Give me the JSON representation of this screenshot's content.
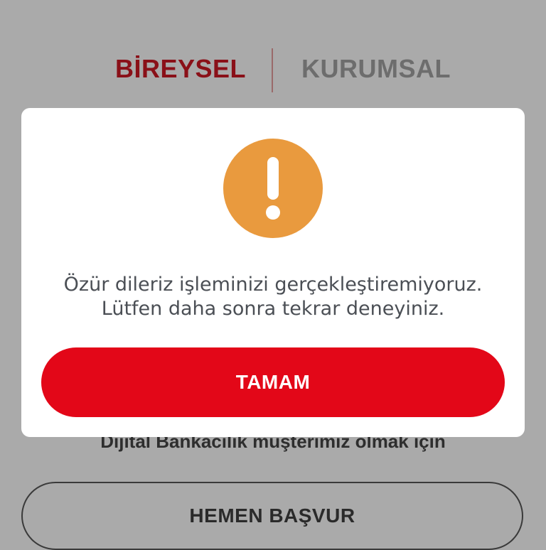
{
  "tabs": {
    "active_label": "BİREYSEL",
    "inactive_label": "KURUMSAL"
  },
  "background": {
    "subtext": "Dijital Bankacılık müşterimiz olmak için",
    "apply_button_label": "HEMEN BAŞVUR"
  },
  "dialog": {
    "icon": "warning-exclamation-icon",
    "message_line1": "Özür dileriz işleminizi gerçekleştiremiyoruz.",
    "message_line2": "Lütfen daha sonra tekrar deneyiniz.",
    "ok_button_label": "TAMAM"
  },
  "colors": {
    "overlay_gray": "#aaaaaa",
    "brand_red": "#e30718",
    "active_tab_red": "#8a1018",
    "warning_orange": "#e99a3e"
  }
}
